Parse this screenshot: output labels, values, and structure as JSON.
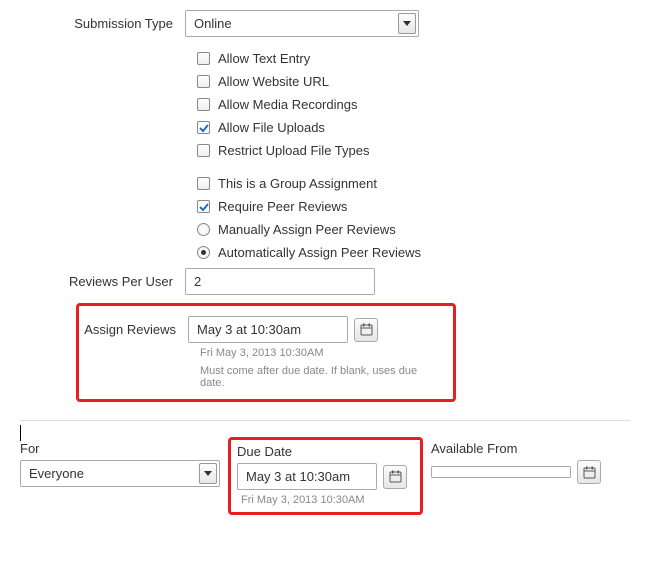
{
  "labels": {
    "submission_type": "Submission Type",
    "reviews_per_user": "Reviews Per User",
    "assign_reviews": "Assign Reviews",
    "for": "For",
    "due_date": "Due Date",
    "available_from": "Available From"
  },
  "submission_type_value": "Online",
  "options": {
    "text_entry": "Allow Text Entry",
    "website_url": "Allow Website URL",
    "media_rec": "Allow Media Recordings",
    "file_uploads": "Allow File Uploads",
    "restrict_types": "Restrict Upload File Types",
    "group_assignment": "This is a Group Assignment",
    "require_peer": "Require Peer Reviews",
    "manually_assign": "Manually Assign Peer Reviews",
    "auto_assign": "Automatically Assign Peer Reviews"
  },
  "reviews_per_user_value": "2",
  "assign_reviews_value": "May 3 at 10:30am",
  "assign_reviews_subtext": "Fri May 3, 2013 10:30AM",
  "assign_reviews_help": "Must come after due date. If blank, uses due date.",
  "for_value": "Everyone",
  "due_date_value": "May 3 at 10:30am",
  "due_date_subtext": "Fri May 3, 2013 10:30AM",
  "available_from_value": ""
}
